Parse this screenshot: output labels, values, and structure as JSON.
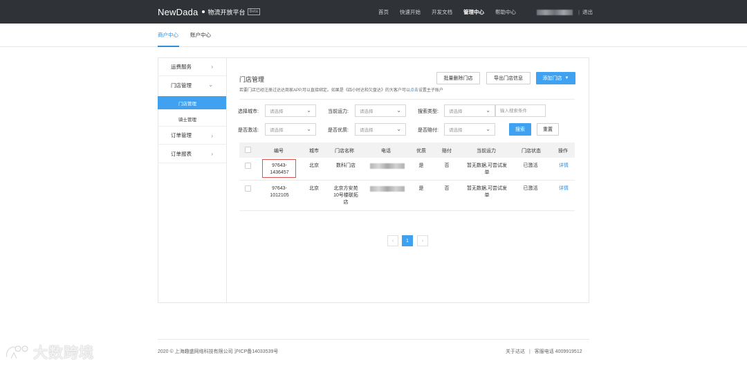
{
  "header": {
    "logo": "NewDada",
    "platform": "物流开放平台",
    "beta": "Beta",
    "nav": [
      "首页",
      "快速开始",
      "开发文档",
      "管理中心",
      "帮助中心"
    ],
    "logout": "退出"
  },
  "subnav": {
    "tabs": [
      "商户中心",
      "账户中心"
    ]
  },
  "sidebar": {
    "items": [
      "运费服务",
      "门店管理",
      "订单管理",
      "订单报表"
    ],
    "subitems": [
      "门店管理",
      "骑士管理"
    ]
  },
  "main": {
    "title": "门店管理",
    "hint_a": "若要门店已经注册过达达商家APP,可以直接绑定。如果是《四小时达和欠盘达》的大客户可以",
    "hint_link": "点击",
    "hint_b": "设置主子账户",
    "buttons": {
      "batch_delete": "批量删除门店",
      "export": "导出门店信息",
      "add": "添加门店"
    }
  },
  "filters": {
    "city_label": "选择城市:",
    "capacity_label": "当前运力:",
    "search_type_label": "搜索类型:",
    "active_label": "是否激活:",
    "quality_label": "是否优质:",
    "compensate_label": "是否赔付:",
    "select_placeholder": "请选择",
    "keyword_placeholder": "输入搜索条件",
    "search": "搜索",
    "reset": "重置"
  },
  "table": {
    "headers": [
      "编号",
      "城市",
      "门店名称",
      "电话",
      "优质",
      "赔付",
      "当前运力",
      "门店状态",
      "操作"
    ],
    "rows": [
      {
        "id1": "97643-",
        "id2": "1436457",
        "city": "北京",
        "name1": "数科门店",
        "name2": "",
        "name3": "",
        "quality": "是",
        "compensate": "否",
        "cap1": "暂无数据,可尝试发",
        "cap2": "单",
        "status": "已激活",
        "action": "详情"
      },
      {
        "id1": "97643-",
        "id2": "1012105",
        "city": "北京",
        "name1": "北京方安苑",
        "name2": "10号楼联拓",
        "name3": "店",
        "quality": "是",
        "compensate": "否",
        "cap1": "暂无数据,可尝试发",
        "cap2": "单",
        "status": "已激活",
        "action": "详情"
      }
    ]
  },
  "pagination": {
    "prev": "‹",
    "current": "1",
    "next": "›"
  },
  "footer": {
    "left": "2020 © 上海趣盛网络科技有限公司 沪ICP备14033539号",
    "about": "关于达达",
    "phone": "客服电话 4009919512"
  },
  "watermark": {
    "text": "大数跨境"
  },
  "icons": {
    "chevron_right": "chevron-right-icon",
    "chevron_down": "chevron-down-icon"
  },
  "colors": {
    "accent": "#3fa1f0",
    "topbar": "#2f3236",
    "highlight": "#d9534f"
  }
}
